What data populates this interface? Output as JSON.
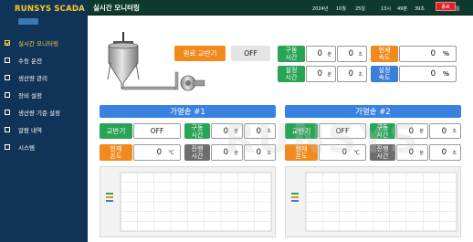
{
  "app_title": "RUNSYS SCADA",
  "header": {
    "title": "실시간 모니터링",
    "exit_label": "종료",
    "datetime": {
      "year": "2024년",
      "month": "10월",
      "day": "25일",
      "hour": "13시",
      "minute": "49분",
      "second": "39초",
      "weekday": "일 요일"
    }
  },
  "sidebar": {
    "items": [
      {
        "label": "실시간 모니터링",
        "active": true
      },
      {
        "label": "수동 운전",
        "active": false
      },
      {
        "label": "생산량 관리",
        "active": false
      },
      {
        "label": "장비 설정",
        "active": false
      },
      {
        "label": "생산량 기준 설정",
        "active": false
      },
      {
        "label": "알람 내역",
        "active": false
      },
      {
        "label": "시스템",
        "active": false
      }
    ]
  },
  "top": {
    "agitator_label": "원료 교반기",
    "agitator_state": "OFF",
    "run_time": {
      "label1": "구동",
      "label2": "시간",
      "minutes": "0",
      "minutes_unit": "분",
      "seconds": "0",
      "seconds_unit": "초"
    },
    "set_time": {
      "label1": "설정",
      "label2": "시간",
      "minutes": "0",
      "minutes_unit": "분",
      "seconds": "0",
      "seconds_unit": "초"
    },
    "current_speed": {
      "label1": "현재",
      "label2": "속도",
      "value": "0",
      "unit": "%"
    },
    "set_speed": {
      "label1": "설정",
      "label2": "속도",
      "value": "0",
      "unit": "%"
    }
  },
  "kettles": [
    {
      "title": "가열솥 #1",
      "agitator_label": "교반기",
      "agitator_state": "OFF",
      "run_time": {
        "label1": "구동",
        "label2": "시간",
        "minutes": "0",
        "minutes_unit": "분",
        "seconds": "0",
        "seconds_unit": "초"
      },
      "temp": {
        "label1": "현재",
        "label2": "온도",
        "value": "0",
        "unit": "℃"
      },
      "progress_time": {
        "label1": "진행",
        "label2": "시간",
        "minutes": "0",
        "minutes_unit": "분",
        "seconds": "0",
        "seconds_unit": "초"
      }
    },
    {
      "title": "가열솥 #2",
      "agitator_label": "교반기",
      "agitator_state": "OFF",
      "run_time": {
        "label1": "구동",
        "label2": "시간",
        "minutes": "0",
        "minutes_unit": "분",
        "seconds": "0",
        "seconds_unit": "초"
      },
      "temp": {
        "label1": "현재",
        "label2": "온도",
        "value": "0",
        "unit": "℃"
      },
      "progress_time": {
        "label1": "진행",
        "label2": "시간",
        "minutes": "0",
        "minutes_unit": "분",
        "seconds": "0",
        "seconds_unit": "초"
      }
    }
  ],
  "watermark": "RUNSYS",
  "colors": {
    "sidebar_bg": "#0f3457",
    "header_bg": "#0d3a2c",
    "title_yellow": "#ffc928",
    "green": "#29a356",
    "orange": "#f08a1d",
    "blue": "#3a7fd8",
    "section_blue": "#3a82e0",
    "exit_red": "#d8242a"
  }
}
